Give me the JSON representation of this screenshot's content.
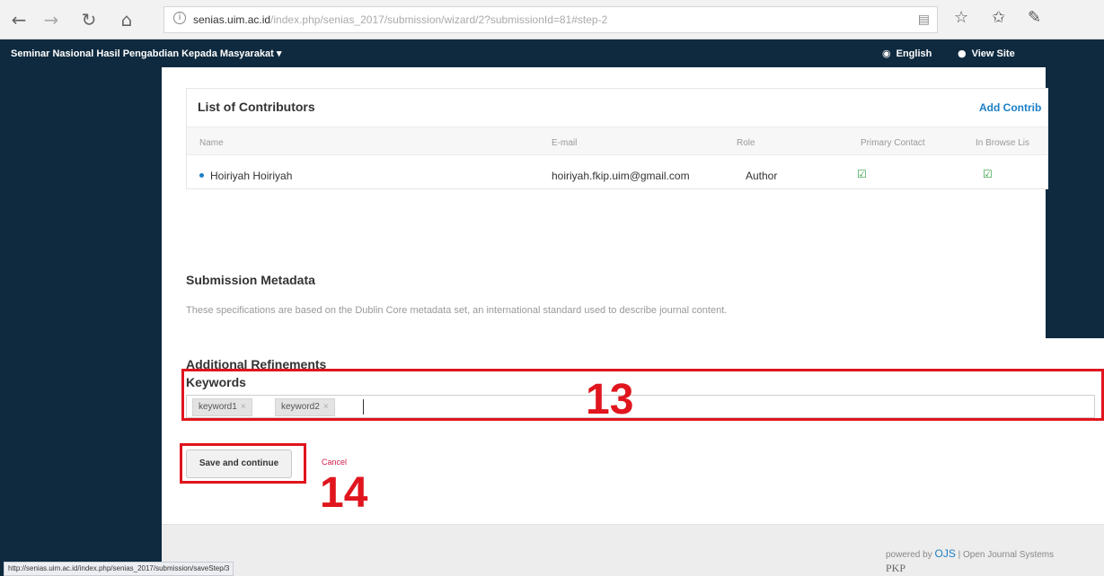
{
  "browser": {
    "url_host": "senias.uim.ac.id",
    "url_rest": "/index.php/senias_2017/submission/wizard/2?submissionId=81#step-2"
  },
  "header": {
    "title": "Seminar Nasional Hasil Pengabdian Kepada Masyarakat",
    "language_label": "English",
    "view_site_label": "View Site"
  },
  "contributors": {
    "title": "List of Contributors",
    "add_label": "Add Contrib",
    "columns": [
      "Name",
      "E-mail",
      "Role",
      "Primary Contact",
      "In Browse Lis"
    ],
    "rows": [
      {
        "name": "Hoiriyah Hoiriyah",
        "email": "hoiriyah.fkip.uim@gmail.com",
        "role": "Author",
        "primary_contact": true,
        "in_browse_list": true
      }
    ]
  },
  "metadata": {
    "title": "Submission Metadata",
    "description": "These specifications are based on the Dublin Core metadata set, an international standard used to describe journal content."
  },
  "refinements": {
    "title": "Additional Refinements",
    "keywords_label": "Keywords",
    "keywords": [
      "keyword1",
      "keyword2"
    ],
    "remove_symbol": "×"
  },
  "actions": {
    "save_label": "Save and continue",
    "cancel_label": "Cancel"
  },
  "annotations": {
    "keywords_number": "13",
    "save_number": "14",
    "color": "#e0151d"
  },
  "footer": {
    "powered_prefix": "powered by",
    "ojs": "OJS",
    "ojs_suffix": "Open Journal Systems",
    "pkp": "PKP"
  },
  "status_bar": {
    "url": "http://senias.uim.ac.id/index.php/senias_2017/submission/saveStep/3"
  },
  "colors": {
    "header_bg": "#0f2a3f",
    "link": "#1c7fc6",
    "cancel": "#d0204a",
    "check": "#2e9e3f"
  }
}
